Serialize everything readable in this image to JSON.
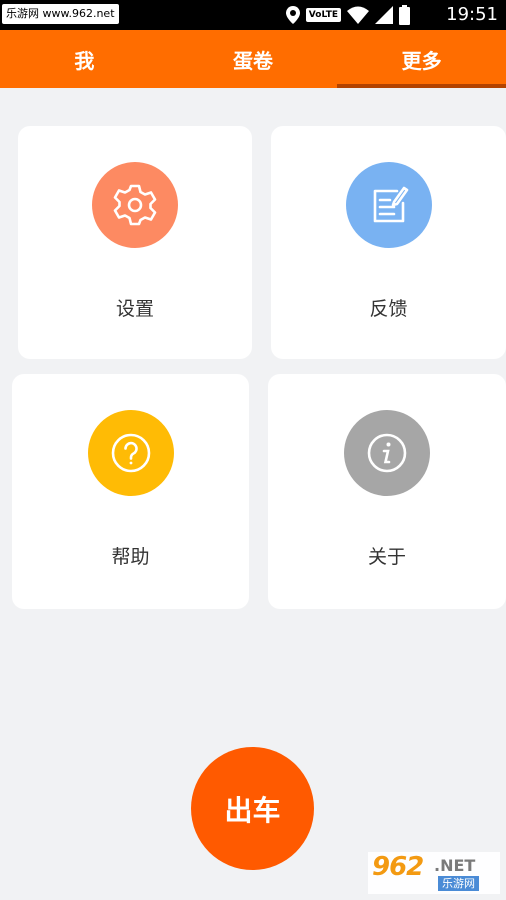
{
  "status_bar": {
    "watermark": "乐游网 www.962.net",
    "network_badge": "VoLTE",
    "time": "19:51",
    "icons": [
      "location-icon",
      "wifi-icon",
      "signal-icon",
      "battery-icon"
    ]
  },
  "tabs": [
    {
      "label": "我",
      "active": false
    },
    {
      "label": "蛋卷",
      "active": false
    },
    {
      "label": "更多",
      "active": true
    }
  ],
  "cards": [
    {
      "label": "设置",
      "icon": "gear-icon",
      "color": "#fd8a62"
    },
    {
      "label": "反馈",
      "icon": "note-pencil-icon",
      "color": "#79b2f2"
    },
    {
      "label": "帮助",
      "icon": "question-icon",
      "color": "#ffbb05"
    },
    {
      "label": "关于",
      "icon": "info-icon",
      "color": "#a6a6a6"
    }
  ],
  "go_button": {
    "label": "出车",
    "color": "#ff5a00"
  },
  "watermark_bottom": {
    "number": "962",
    "suffix": ".NET",
    "text": "乐游网"
  },
  "colors": {
    "accent": "#ff6d00",
    "background": "#f1f2f4"
  }
}
